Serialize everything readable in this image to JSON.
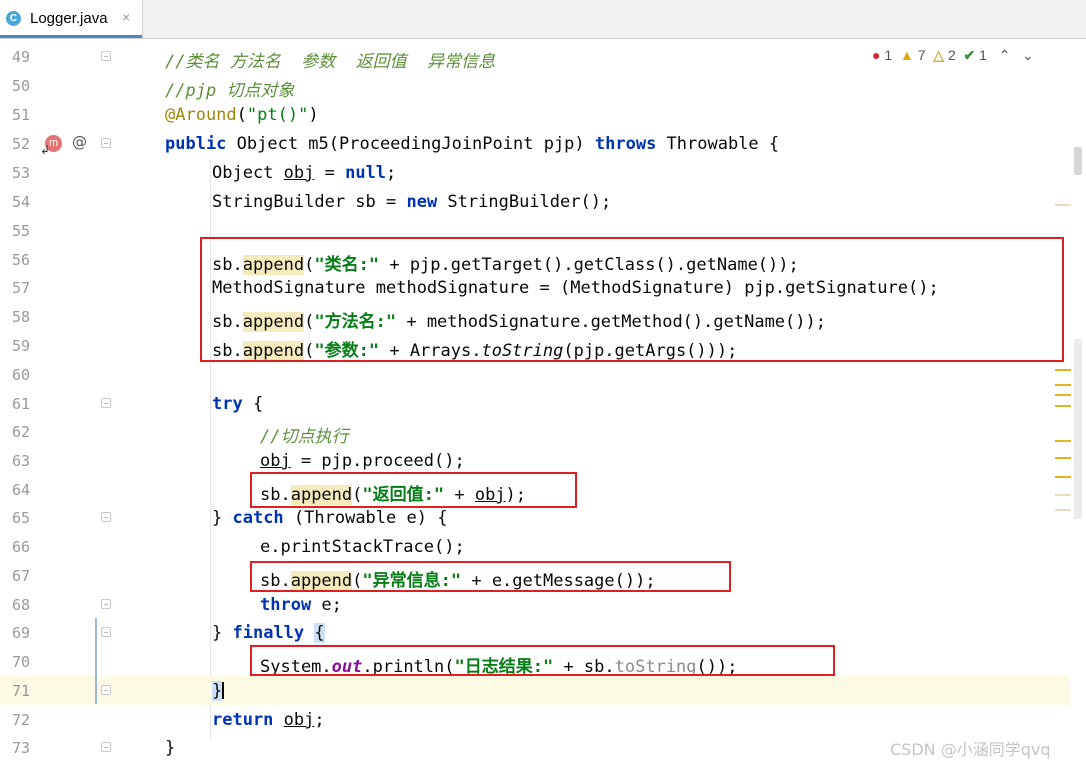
{
  "tab": {
    "icon": "C",
    "label": "Logger.java",
    "close": "×"
  },
  "inspections": {
    "errors": "1",
    "warnings": "7",
    "weak_warnings": "2",
    "typos": "1"
  },
  "line_numbers": [
    "49",
    "50",
    "51",
    "52",
    "53",
    "54",
    "55",
    "56",
    "57",
    "58",
    "59",
    "60",
    "61",
    "62",
    "63",
    "64",
    "65",
    "66",
    "67",
    "68",
    "69",
    "70",
    "71",
    "72",
    "73"
  ],
  "gutter_icons": {
    "method_override": "m",
    "annotation": "@"
  },
  "code": {
    "l49": "//类名 方法名  参数  返回值  异常信息",
    "l50": "//pjp 切点对象",
    "l51_ann": "@Around",
    "l51_str": "\"pt()\"",
    "l52_sig": " Object m5(ProceedingJoinPoint pjp) ",
    "l52_tail": " Throwable {",
    "l53_a": "Object ",
    "l53_var": "obj",
    "l53_b": " = ",
    "l53_null": "null",
    "l53_c": ";",
    "l54_a": "StringBuilder sb = ",
    "l54_new": "new",
    "l54_b": " StringBuilder();",
    "sb": "sb.",
    "append": "append",
    "l56_str": "\"类名:\"",
    "l56_tail": " + pjp.getTarget().getClass().getName());",
    "l57": "MethodSignature methodSignature = (MethodSignature) pjp.getSignature();",
    "l58_str": "\"方法名:\"",
    "l58_tail": " + methodSignature.getMethod().getName());",
    "l59_str": "\"参数:\"",
    "l59_mid": " + Arrays.",
    "l59_ital": "toString",
    "l59_tail": "(pjp.getArgs()));",
    "try": "try",
    "brace_open": " {",
    "l62": "//切点执行",
    "l63_var": "obj",
    "l63_tail": " = pjp.proceed();",
    "l64_str": "\"返回值:\"",
    "l64_plus": " + ",
    "l64_var": "obj",
    "l64_tail": ");",
    "l65_a": "} ",
    "catch": "catch",
    "l65_b": " (Throwable e) {",
    "l66": "e.printStackTrace();",
    "l67_str": "\"异常信息:\"",
    "l67_tail": " + e.getMessage());",
    "throw": "throw",
    "l68_tail": " e;",
    "l69_a": "} ",
    "finally": "finally",
    "l70_a": "System.",
    "l70_out": "out",
    "l70_b": ".println(",
    "l70_str": "\"日志结果:\"",
    "l70_c": " + sb.",
    "l70_grey": "toString",
    "l70_d": "());",
    "l71": "}",
    "return": "return",
    "l72_var": "obj",
    "l72_tail": ";",
    "l73": "}",
    "paren_open": "(",
    "paren_close": ")",
    "public": "public",
    "throws": "throws"
  },
  "watermark": "CSDN @小涵同学qvq"
}
